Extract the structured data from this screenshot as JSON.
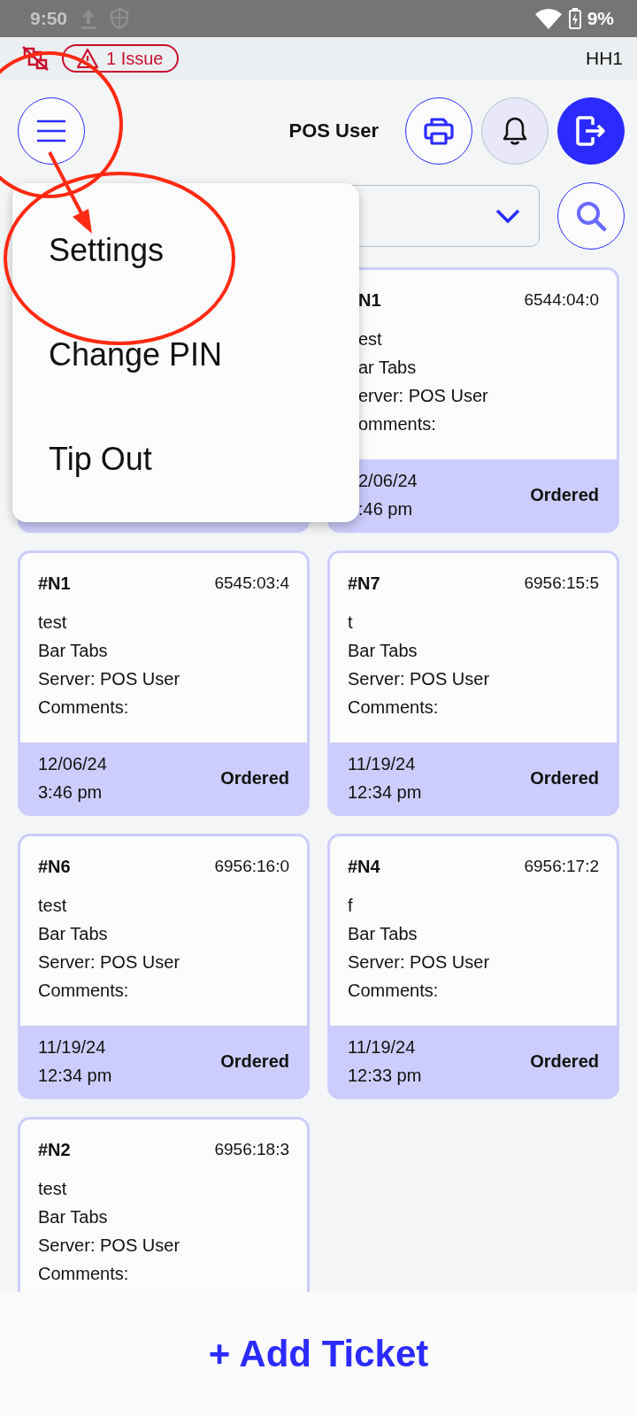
{
  "status_bar": {
    "time": "9:50",
    "battery": "9%"
  },
  "header": {
    "issues": "1 Issue",
    "device": "HH1"
  },
  "toolbar": {
    "user": "POS User"
  },
  "menu": {
    "items": [
      {
        "label": "Settings"
      },
      {
        "label": "Change PIN"
      },
      {
        "label": "Tip Out"
      }
    ]
  },
  "tickets": [
    {
      "kind": "covered"
    },
    {
      "kind": "partial",
      "number": "N1",
      "code": "6544:04:0",
      "lines": [
        "est",
        "ar Tabs",
        "erver: POS User",
        "omments:"
      ],
      "date": "2/06/24",
      "time": ":46 pm",
      "status": "Ordered"
    },
    {
      "kind": "full",
      "number": "#N1",
      "code": "6545:03:4",
      "lines": [
        "test",
        "Bar Tabs",
        "Server: POS User",
        "Comments:"
      ],
      "date": "12/06/24",
      "time": "3:46 pm",
      "status": "Ordered"
    },
    {
      "kind": "full",
      "number": "#N7",
      "code": "6956:15:5",
      "lines": [
        "t",
        "Bar Tabs",
        "Server: POS User",
        "Comments:"
      ],
      "date": "11/19/24",
      "time": "12:34 pm",
      "status": "Ordered"
    },
    {
      "kind": "full",
      "number": "#N6",
      "code": "6956:16:0",
      "lines": [
        "test",
        "Bar Tabs",
        "Server: POS User",
        "Comments:"
      ],
      "date": "11/19/24",
      "time": "12:34 pm",
      "status": "Ordered"
    },
    {
      "kind": "full",
      "number": "#N4",
      "code": "6956:17:2",
      "lines": [
        "f",
        "Bar Tabs",
        "Server: POS User",
        "Comments:"
      ],
      "date": "11/19/24",
      "time": "12:33 pm",
      "status": "Ordered"
    },
    {
      "kind": "full",
      "number": "#N2",
      "code": "6956:18:3",
      "lines": [
        "test",
        "Bar Tabs",
        "Server: POS User",
        "Comments:"
      ]
    }
  ],
  "add_button": "+ Add Ticket"
}
